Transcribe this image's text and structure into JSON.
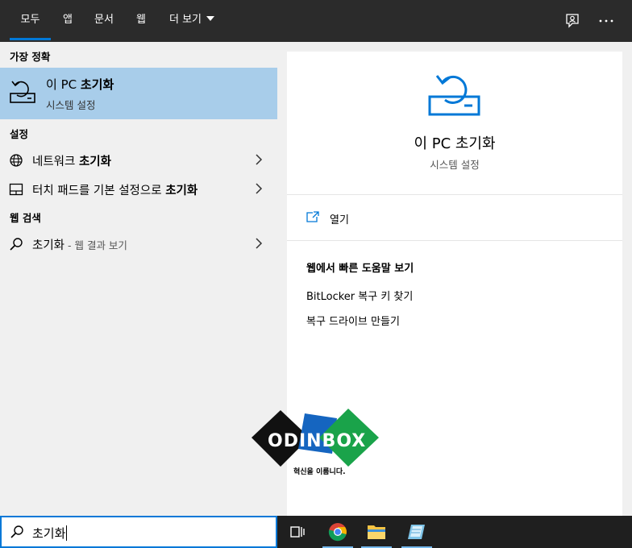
{
  "tabs": [
    {
      "label": "모두",
      "active": true
    },
    {
      "label": "앱"
    },
    {
      "label": "문서"
    },
    {
      "label": "웹"
    },
    {
      "label": "더 보기"
    }
  ],
  "left": {
    "best_match_header": "가장 정확",
    "best_match": {
      "title_prefix": "이 PC ",
      "title_bold": "초기화",
      "subtitle": "시스템 설정"
    },
    "settings_header": "설정",
    "settings_items": [
      {
        "prefix": "네트워크 ",
        "bold": "초기화",
        "icon": "globe-icon"
      },
      {
        "prefix": "터치 패드를 기본 설정으로 ",
        "bold": "초기화",
        "icon": "touchpad-icon"
      }
    ],
    "web_header": "웹 검색",
    "web_item": {
      "query": "초기화",
      "hint": " - 웹 결과 보기"
    }
  },
  "right": {
    "title": "이 PC 초기화",
    "subtitle": "시스템 설정",
    "open_label": "열기",
    "web_help_header": "웹에서 빠른 도움말 보기",
    "web_links": [
      "BitLocker 복구 키 찾기",
      "복구 드라이브 만들기"
    ]
  },
  "logo": {
    "text": "ODINBOX",
    "tagline": "혁신을 이룹니다."
  },
  "search": {
    "value": "초기화"
  },
  "colors": {
    "accent": "#0078d7",
    "selection": "#a8cdea",
    "topbar": "#2b2b2b",
    "taskbar": "#1f1f1f"
  }
}
